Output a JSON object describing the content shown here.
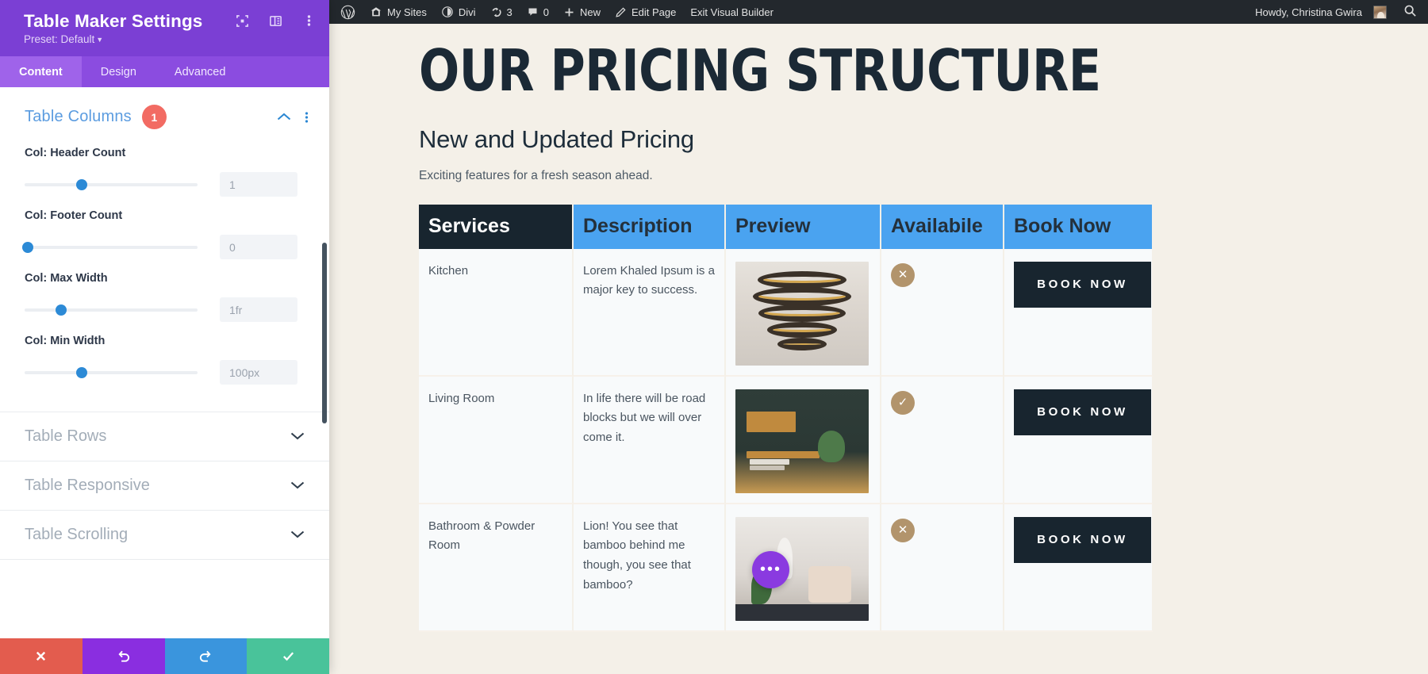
{
  "settings_panel": {
    "title": "Table Maker Settings",
    "preset_label": "Preset: Default",
    "header_icons": [
      "expand-icon",
      "layout-icon",
      "more-vertical-icon"
    ],
    "tabs": [
      {
        "label": "Content",
        "active": true
      },
      {
        "label": "Design",
        "active": false
      },
      {
        "label": "Advanced",
        "active": false
      }
    ],
    "section": {
      "title": "Table Columns",
      "badge": "1",
      "collapse_icon": "chevron-up-icon",
      "more_icon": "more-vertical-icon",
      "fields": [
        {
          "label": "Col: Header Count",
          "value": "1",
          "knob_pct": 33
        },
        {
          "label": "Col: Footer Count",
          "value": "0",
          "knob_pct": 2
        },
        {
          "label": "Col: Max Width",
          "value": "1fr",
          "knob_pct": 21
        },
        {
          "label": "Col: Min Width",
          "value": "100px",
          "knob_pct": 33
        }
      ]
    },
    "collapsed_sections": [
      {
        "label": "Table Rows"
      },
      {
        "label": "Table Responsive"
      },
      {
        "label": "Table Scrolling"
      }
    ],
    "footer_buttons": [
      {
        "name": "cancel",
        "icon": "close-icon"
      },
      {
        "name": "undo",
        "icon": "undo-icon"
      },
      {
        "name": "redo",
        "icon": "redo-icon"
      },
      {
        "name": "save",
        "icon": "check-icon"
      }
    ],
    "colors": {
      "header_bg": "#7b3fd4",
      "tabs_bg": "#8b4ce0",
      "active_tab_bg": "#9f63ea",
      "accent_blue": "#2c8ad6",
      "badge_red": "#f26b63"
    }
  },
  "admin_bar": {
    "items": [
      {
        "label": "",
        "icon": "wordpress-logo-icon"
      },
      {
        "label": "My Sites",
        "icon": "sites-icon"
      },
      {
        "label": "Divi",
        "icon": "divi-icon"
      },
      {
        "label": "3",
        "icon": "updates-icon"
      },
      {
        "label": "0",
        "icon": "comment-icon"
      },
      {
        "label": "New",
        "icon": "plus-icon"
      },
      {
        "label": "Edit Page",
        "icon": "pencil-icon"
      },
      {
        "label": "Exit Visual Builder",
        "icon": ""
      }
    ],
    "howdy": "Howdy, Christina Gwira",
    "search_icon": "search-icon",
    "bg": "#23282d"
  },
  "page": {
    "title": "OUR PRICING STRUCTURE",
    "subtitle": "New and Updated Pricing",
    "description": "Exciting features for a fresh season ahead.",
    "fab_icon": "ellipsis-icon",
    "background": "#f4f0e8"
  },
  "table": {
    "headers": [
      "Services",
      "Description",
      "Preview",
      "Availabile",
      "Book Now"
    ],
    "header_bg": "#4aa3f0",
    "first_header_bg": "#18252f",
    "rows": [
      {
        "service": "Kitchen",
        "description": "Lorem Khaled Ipsum is a major key to success.",
        "preview": "kitchen-photo",
        "available": false,
        "available_icon": "close-circle-icon",
        "book_label": "BOOK NOW"
      },
      {
        "service": "Living Room",
        "description": "In life there will be road blocks but we will over come it.",
        "preview": "living-room-photo",
        "available": true,
        "available_icon": "check-circle-icon",
        "book_label": "BOOK NOW"
      },
      {
        "service": "Bathroom & Powder Room",
        "description": "Lion! You see that bamboo behind me though, you see that bamboo?",
        "preview": "bathroom-photo",
        "available": false,
        "available_icon": "close-circle-icon",
        "book_label": "BOOK NOW"
      }
    ]
  }
}
